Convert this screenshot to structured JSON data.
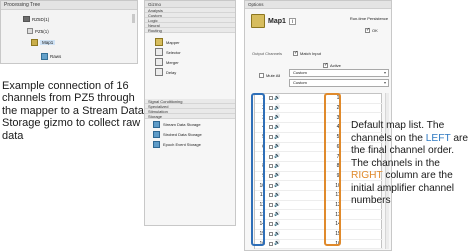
{
  "tree": {
    "title": "Processing Tree",
    "items": [
      {
        "label": "RZ5D(1)"
      },
      {
        "label": "PZ5(1)"
      },
      {
        "label": "Map1"
      },
      {
        "label": "Raws"
      }
    ]
  },
  "annotations": {
    "left": "Example connection of 16 channels from PZ5 through the mapper to a Stream Data Storage gizmo to collect raw data",
    "right_1": "Default map list. The channels on the ",
    "right_left": "LEFT",
    "right_2": " are the final channel order. The channels in the ",
    "right_right": "RIGHT",
    "right_3": " column are the initial amplifier channel numbers"
  },
  "gizmos": {
    "title": "Gizmo",
    "groups": [
      "Analysis",
      "Custom",
      "Logic",
      "Neural",
      "Routing"
    ],
    "routing_items": [
      "Mapper",
      "Selector",
      "Merger",
      "Delay"
    ],
    "groups2": [
      "Signal Conditioning",
      "Specialized",
      "Stimulation",
      "Storage"
    ],
    "storage_items": [
      "Stream Data Storage",
      "Strobed Data Storage",
      "Epoch Event Storage"
    ]
  },
  "options": {
    "title": "Options",
    "map_name": "Map1",
    "runtime_label": "Run-time Persistence",
    "runtime_ok": "OK",
    "output_channels_label": "Output Channels",
    "match_input_label": "Match Input",
    "active_label": "Active",
    "mute_all_label": "Mute All",
    "select_1": "Custom",
    "select_2": "Custom",
    "channels_out": [
      "1",
      "2",
      "3",
      "4",
      "5",
      "6",
      "7",
      "8",
      "9",
      "10",
      "11",
      "12",
      "13",
      "14",
      "15",
      "16"
    ],
    "channels_in": [
      "1",
      "2",
      "3",
      "4",
      "5",
      "6",
      "7",
      "8",
      "9",
      "10",
      "11",
      "12",
      "13",
      "14",
      "15",
      "16"
    ]
  },
  "colors": {
    "left_highlight": "#2f6fb8",
    "right_highlight": "#e08a2c"
  }
}
